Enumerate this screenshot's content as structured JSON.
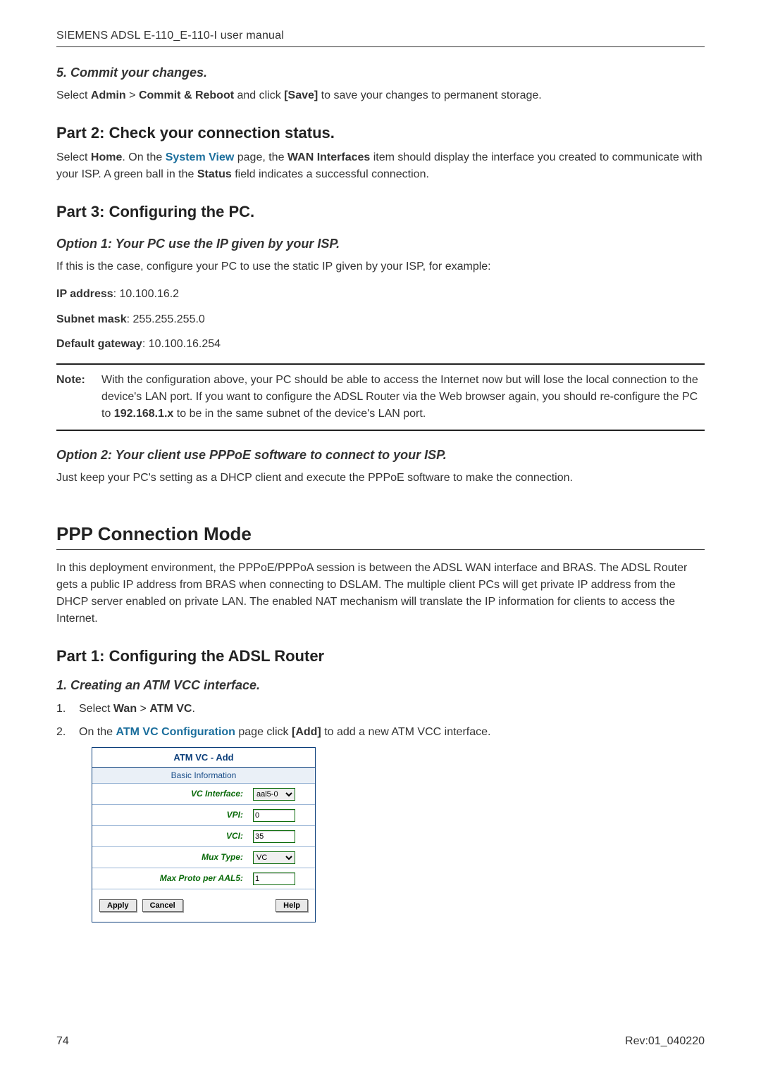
{
  "header": {
    "title": "SIEMENS ADSL E-110_E-110-I user manual"
  },
  "step5": {
    "heading": "5. Commit your changes.",
    "p_pre": "Select ",
    "admin": "Admin",
    "gt1": " > ",
    "commit": "Commit & Reboot",
    "p_mid": " and click ",
    "save": "[Save]",
    "p_post": " to save your changes to permanent storage."
  },
  "part2": {
    "heading": "Part 2: Check your connection status.",
    "p1_pre": "Select ",
    "home": "Home",
    "p1_a": ". On the ",
    "sysview": "System View",
    "p1_b": " page, the ",
    "wan": "WAN Interfaces",
    "p1_c": " item should display the interface you created to communicate with your ISP. A green ball in the ",
    "status": "Status",
    "p1_d": " field indicates a successful connection."
  },
  "part3": {
    "heading": "Part 3: Configuring the PC.",
    "opt1_heading": "Option 1: Your PC use the IP given by your ISP.",
    "opt1_para": "If this is the case, configure your PC to use the static IP given by your ISP, for example:",
    "ip_label": "IP address",
    "ip_val": ": 10.100.16.2",
    "mask_label": "Subnet mask",
    "mask_val": ": 255.255.255.0",
    "gw_label": "Default gateway",
    "gw_val": ": 10.100.16.254",
    "note_label": "Note:",
    "note_a": "With the configuration above, your PC should be able to access the Internet now but will lose the local connection to the device's LAN port. If you want to configure the ADSL Router via the Web browser again, you should re-configure the PC to ",
    "note_ip": "192.168.1.x",
    "note_b": " to be in the same subnet of the device's LAN port.",
    "opt2_heading": "Option 2: Your client use PPPoE software to connect to your ISP.",
    "opt2_para": "Just keep your PC's setting as a DHCP client and execute the PPPoE software to make the connection."
  },
  "ppp": {
    "heading": "PPP Connection Mode",
    "para": "In this deployment environment, the PPPoE/PPPoA session is between the ADSL WAN interface and BRAS. The ADSL Router gets a public IP address from BRAS when connecting to DSLAM. The multiple client PCs will get private IP address from the DHCP server enabled on private LAN. The enabled NAT mechanism will translate the IP information for clients to access the Internet.",
    "part1_heading": "Part 1: Configuring the ADSL Router",
    "step1_heading": "1. Creating an ATM VCC interface.",
    "li1_pre": "Select ",
    "li1_wan": "Wan",
    "li1_gt": " > ",
    "li1_atm": "ATM VC",
    "li1_post": ".",
    "li2_pre": "On the ",
    "li2_link": "ATM VC Configuration",
    "li2_mid": " page click ",
    "li2_add": "[Add]",
    "li2_post": " to add a new ATM VCC interface."
  },
  "atm_panel": {
    "title": "ATM VC - Add",
    "section": "Basic Information",
    "rows": {
      "vc_label": "VC Interface:",
      "vc_value": "aal5-0",
      "vpi_label": "VPI:",
      "vpi_value": "0",
      "vci_label": "VCI:",
      "vci_value": "35",
      "mux_label": "Mux Type:",
      "mux_value": "VC",
      "max_label": "Max Proto per AAL5:",
      "max_value": "1"
    },
    "buttons": {
      "apply": "Apply",
      "cancel": "Cancel",
      "help": "Help"
    }
  },
  "footer": {
    "page": "74",
    "rev": "Rev:01_040220"
  }
}
